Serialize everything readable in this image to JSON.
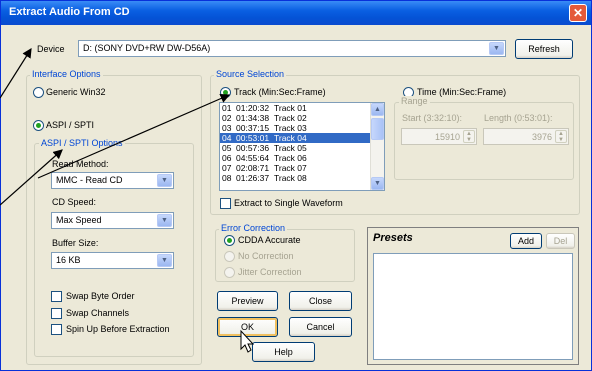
{
  "window": {
    "title": "Extract Audio From CD",
    "close_glyph": "✕"
  },
  "device": {
    "label": "Device",
    "value": "D: (SONY DVD+RW DW-D56A)",
    "refresh_label": "Refresh"
  },
  "interface_options": {
    "group_label": "Interface Options",
    "generic_win32": "Generic Win32",
    "aspi_spti": "ASPI / SPTI",
    "aspi_options_label": "ASPI / SPTI Options",
    "read_method_label": "Read Method:",
    "read_method_value": "MMC - Read CD",
    "cd_speed_label": "CD Speed:",
    "cd_speed_value": "Max Speed",
    "buffer_size_label": "Buffer Size:",
    "buffer_size_value": "16 KB",
    "swap_byte_order": "Swap Byte Order",
    "swap_channels": "Swap Channels",
    "spin_up": "Spin Up Before Extraction"
  },
  "source_selection": {
    "group_label": "Source Selection",
    "track_label": "Track (Min:Sec:Frame)",
    "time_label": "Time (Min:Sec:Frame)",
    "range_label": "Range",
    "start_label": "Start (3:32:10):",
    "start_value": "15910",
    "length_label": "Length (0:53:01):",
    "length_value": "3976",
    "extract_single_label": "Extract to Single Waveform",
    "tracks": [
      {
        "num": "01",
        "time": "01:20:32",
        "name": "Track 01",
        "selected": false
      },
      {
        "num": "02",
        "time": "01:34:38",
        "name": "Track 02",
        "selected": false
      },
      {
        "num": "03",
        "time": "00:37:15",
        "name": "Track 03",
        "selected": false
      },
      {
        "num": "04",
        "time": "00:53:01",
        "name": "Track 04",
        "selected": true
      },
      {
        "num": "05",
        "time": "00:57:36",
        "name": "Track 05",
        "selected": false
      },
      {
        "num": "06",
        "time": "04:55:64",
        "name": "Track 06",
        "selected": false
      },
      {
        "num": "07",
        "time": "02:08:71",
        "name": "Track 07",
        "selected": false
      },
      {
        "num": "08",
        "time": "01:26:37",
        "name": "Track 08",
        "selected": false
      }
    ]
  },
  "error_correction": {
    "group_label": "Error Correction",
    "cdda_accurate": "CDDA Accurate",
    "no_correction": "No Correction",
    "jitter_correction": "Jitter Correction"
  },
  "presets": {
    "title": "Presets",
    "add_label": "Add",
    "del_label": "Del"
  },
  "buttons": {
    "preview": "Preview",
    "close": "Close",
    "ok": "OK",
    "cancel": "Cancel",
    "help": "Help"
  }
}
